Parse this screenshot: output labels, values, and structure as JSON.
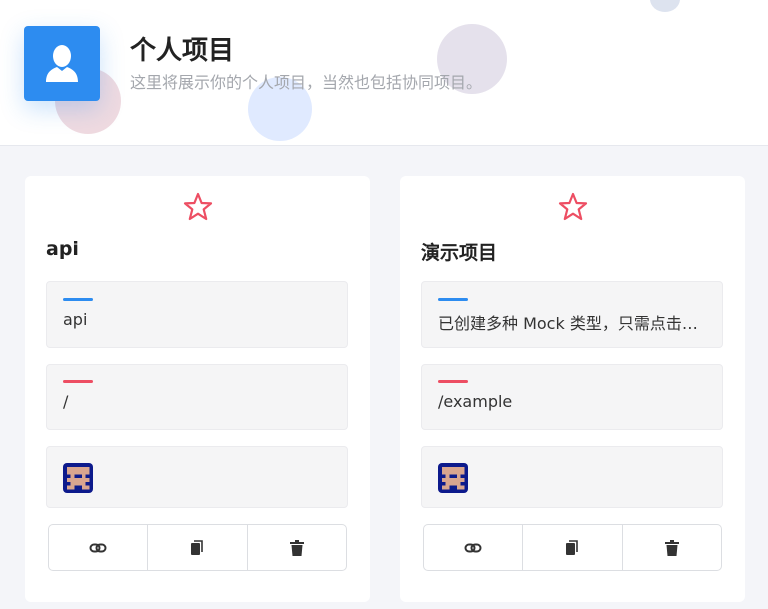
{
  "header": {
    "title": "个人项目",
    "subtitle": "这里将展示你的个人项目，当然也包括协同项目。",
    "icon": "user-icon",
    "accent": "#2d8cf0"
  },
  "projects": [
    {
      "name": "api",
      "description": "api",
      "base_url": "/",
      "starred": false,
      "member_avatar": "pixel-avatar",
      "actions": [
        "link-icon",
        "copy-icon",
        "trash-icon"
      ]
    },
    {
      "name": "演示项目",
      "description": "已创建多种 Mock 类型，只需点击预览便可查看效果。",
      "base_url": "/example",
      "starred": false,
      "member_avatar": "pixel-avatar",
      "actions": [
        "link-icon",
        "copy-icon",
        "trash-icon"
      ]
    }
  ],
  "colors": {
    "star": "#ed4e63",
    "description_bar": "#2d8cf0",
    "url_bar": "#ed4e63"
  }
}
